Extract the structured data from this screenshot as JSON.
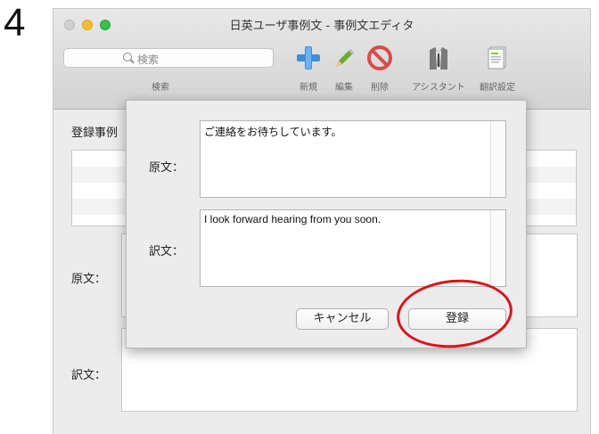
{
  "step": {
    "number": "4"
  },
  "window": {
    "title": "日英ユーザ事例文 - 事例文エディタ"
  },
  "search": {
    "placeholder": "検索",
    "label": "検索"
  },
  "toolbar": {
    "new_label": "新規",
    "edit_label": "編集",
    "delete_label": "削除",
    "assistant_label": "アシスタント",
    "translation_settings_label": "翻訳設定"
  },
  "background": {
    "registered_label": "登録事例",
    "source_label": "原文：",
    "translation_label": "訳文："
  },
  "dialog": {
    "source_label": "原文：",
    "source_text": "ご連絡をお待ちしています。",
    "translation_label": "訳文：",
    "translation_text": "I look forward hearing from you soon.",
    "cancel_label": "キャンセル",
    "register_label": "登録"
  },
  "colors": {
    "highlight": "#d8141c",
    "close_light": "#d0d0d0",
    "minimize_light": "#f6be2f",
    "zoom_light": "#38c149"
  },
  "icons": {
    "new": "plus-icon",
    "edit": "pencil-icon",
    "delete": "prohibit-icon",
    "assistant": "jacket-icon",
    "translation_settings": "document-icon",
    "search": "magnifier-icon"
  }
}
